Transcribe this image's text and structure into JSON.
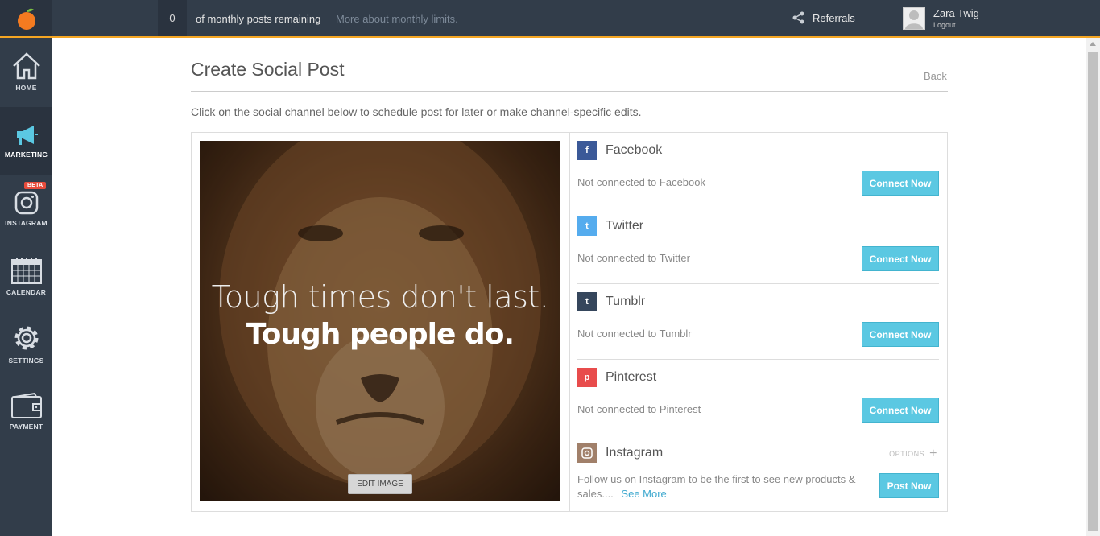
{
  "topbar": {
    "post_count": "0",
    "limit_text": "of monthly posts remaining",
    "limit_link": "More about monthly limits.",
    "referrals": "Referrals",
    "user_name": "Zara Twig",
    "logout": "Logout"
  },
  "sidebar": {
    "items": [
      {
        "label": "HOME",
        "icon": "home-icon"
      },
      {
        "label": "MARKETING",
        "icon": "megaphone-icon"
      },
      {
        "label": "INSTAGRAM",
        "icon": "instagram-icon",
        "badge": "BETA"
      },
      {
        "label": "CALENDAR",
        "icon": "calendar-icon"
      },
      {
        "label": "SETTINGS",
        "icon": "gear-icon"
      },
      {
        "label": "PAYMENT",
        "icon": "wallet-icon"
      }
    ]
  },
  "main": {
    "title": "Create Social Post",
    "back": "Back",
    "instructions": "Click on the social channel below to schedule post for later or make channel-specific edits.",
    "image": {
      "quote_line1": "Tough times don't last.",
      "quote_line2": "Tough people do.",
      "edit_button": "EDIT IMAGE"
    },
    "channels": [
      {
        "name": "Facebook",
        "status": "Not connected to Facebook",
        "button": "Connect Now",
        "color": "#3b5998",
        "glyph": "f"
      },
      {
        "name": "Twitter",
        "status": "Not connected to Twitter",
        "button": "Connect Now",
        "color": "#55acee",
        "glyph": "t"
      },
      {
        "name": "Tumblr",
        "status": "Not connected to Tumblr",
        "button": "Connect Now",
        "color": "#35465c",
        "glyph": "t"
      },
      {
        "name": "Pinterest",
        "status": "Not connected to Pinterest",
        "button": "Connect Now",
        "color": "#e84c4c",
        "glyph": "p"
      }
    ],
    "instagram": {
      "name": "Instagram",
      "options": "OPTIONS",
      "text": "Follow us on Instagram to be the first to see new products & sales....",
      "see_more": "See More",
      "button": "Post Now",
      "color": "#a1806a"
    }
  },
  "colors": {
    "topbar": "#323d4a",
    "accent": "#f5a623",
    "button": "#5bc8e2"
  }
}
